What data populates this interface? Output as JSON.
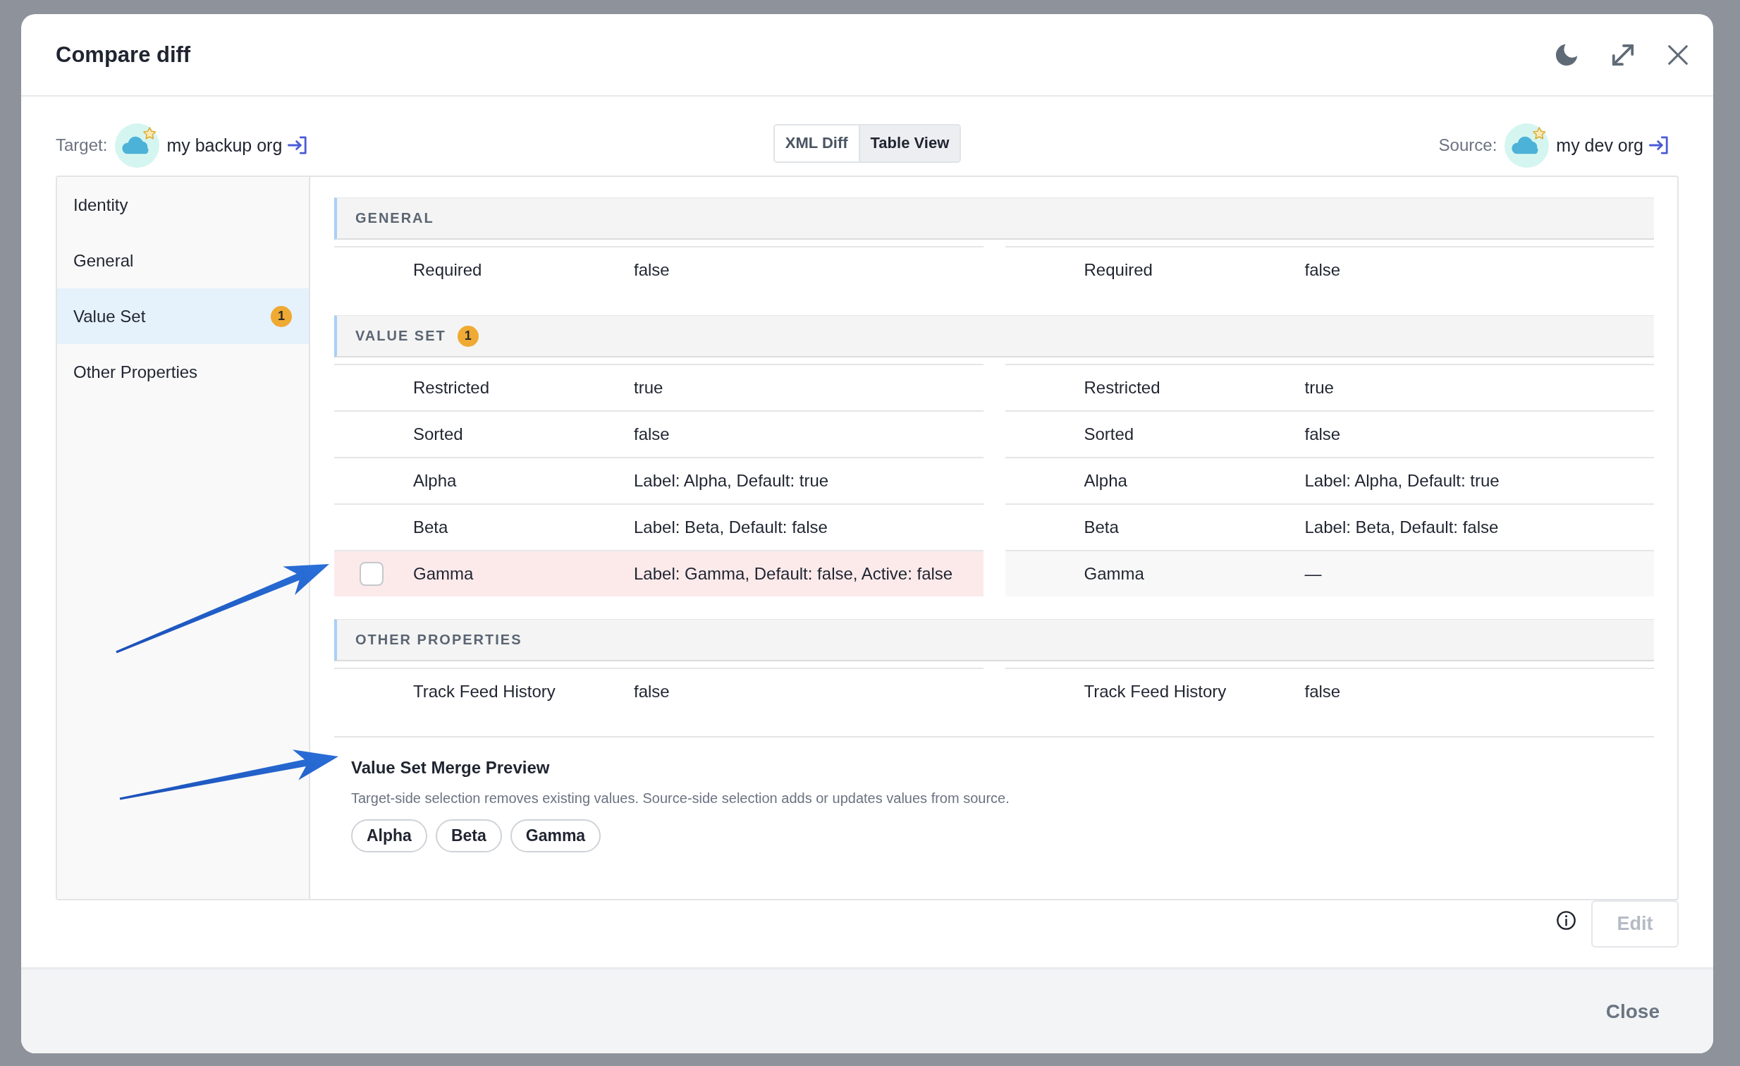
{
  "dialog": {
    "title": "Compare diff"
  },
  "target": {
    "label": "Target:",
    "org": "my backup org"
  },
  "view_toggle": [
    {
      "label": "XML Diff",
      "selected": false
    },
    {
      "label": "Table View",
      "selected": true
    }
  ],
  "source": {
    "label": "Source:",
    "org": "my dev org"
  },
  "sidebar": {
    "items": [
      {
        "label": "Identity",
        "selected": false
      },
      {
        "label": "General",
        "selected": false
      },
      {
        "label": "Value Set",
        "selected": true,
        "badge": "1"
      },
      {
        "label": "Other Properties",
        "selected": false
      }
    ]
  },
  "sections": [
    {
      "title": "GENERAL",
      "rows": [
        {
          "kind": "same",
          "target": {
            "label": "Required",
            "value": "false"
          },
          "source": {
            "label": "Required",
            "value": "false"
          }
        }
      ]
    },
    {
      "title": "VALUE SET",
      "badge": "1",
      "rows": [
        {
          "kind": "same",
          "target": {
            "label": "Restricted",
            "value": "true"
          },
          "source": {
            "label": "Restricted",
            "value": "true"
          }
        },
        {
          "kind": "same",
          "target": {
            "label": "Sorted",
            "value": "false"
          },
          "source": {
            "label": "Sorted",
            "value": "false"
          }
        },
        {
          "kind": "same",
          "target": {
            "label": "Alpha",
            "value": "Label: Alpha, Default: true"
          },
          "source": {
            "label": "Alpha",
            "value": "Label: Alpha, Default: true"
          }
        },
        {
          "kind": "same",
          "target": {
            "label": "Beta",
            "value": "Label: Beta, Default: false"
          },
          "source": {
            "label": "Beta",
            "value": "Label: Beta, Default: false"
          }
        },
        {
          "kind": "diff",
          "target": {
            "label": "Gamma",
            "value": "Label: Gamma, Default: false, Active: false",
            "checked": false
          },
          "source": {
            "label": "Gamma",
            "value": "—"
          }
        }
      ]
    },
    {
      "title": "OTHER PROPERTIES",
      "rows": [
        {
          "kind": "same",
          "target": {
            "label": "Track Feed History",
            "value": "false"
          },
          "source": {
            "label": "Track Feed History",
            "value": "false"
          }
        }
      ]
    }
  ],
  "merge_preview": {
    "title": "Value Set Merge Preview",
    "description": "Target-side selection removes existing values. Source-side selection adds or updates values from source.",
    "chips": [
      "Alpha",
      "Beta",
      "Gamma"
    ]
  },
  "edit_button": {
    "label": "Edit",
    "disabled": true
  },
  "close_button": {
    "label": "Close"
  }
}
